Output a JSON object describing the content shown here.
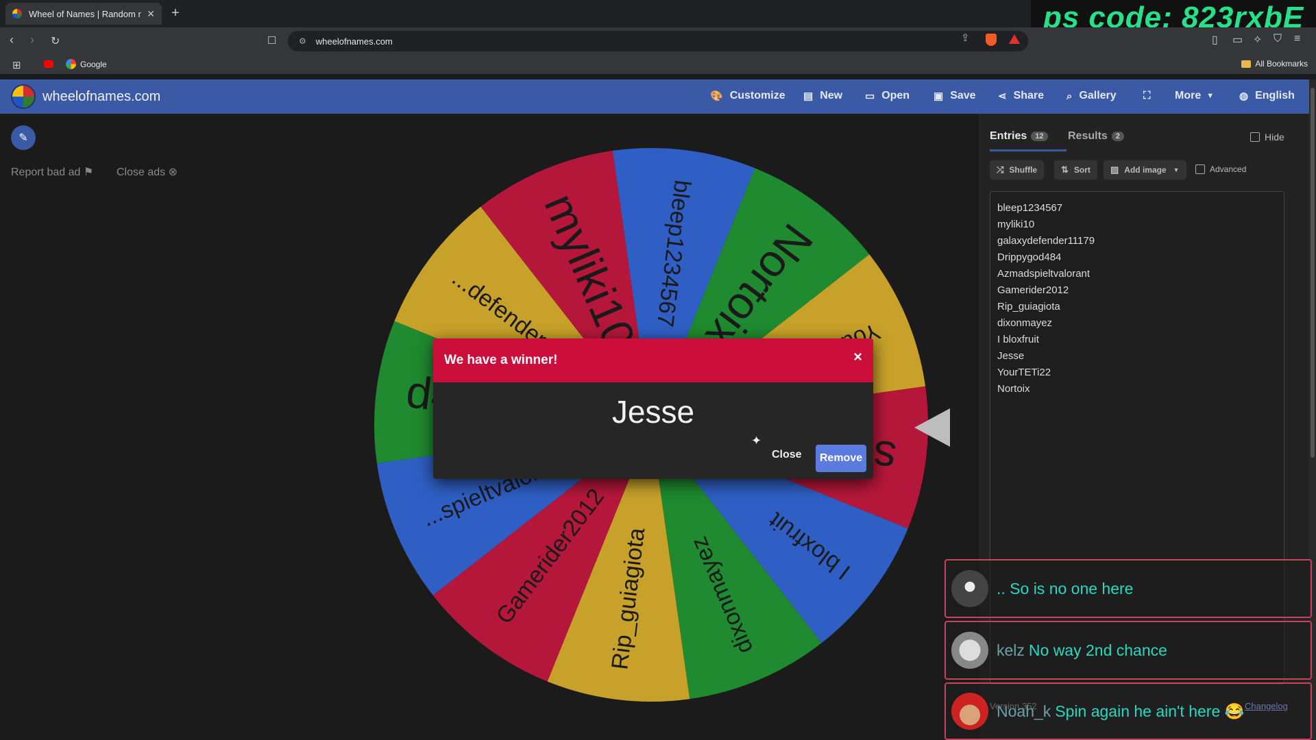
{
  "browser": {
    "tab_title": "Wheel of Names | Random nam",
    "new_tab_symbol": "+",
    "url": "wheelofnames.com",
    "bookmark_google": "Google",
    "all_bookmarks": "All Bookmarks"
  },
  "overlay": {
    "ps_code": "ps code: 823rxbE"
  },
  "header": {
    "site_name": "wheelofnames.com",
    "nav": {
      "customize": "Customize",
      "new": "New",
      "open": "Open",
      "save": "Save",
      "share": "Share",
      "gallery": "Gallery",
      "more": "More",
      "language": "English"
    }
  },
  "left": {
    "report_bad_ad": "Report bad ad",
    "close_ads": "Close ads"
  },
  "wheel": {
    "colors": {
      "red": "#b5173a",
      "yellow": "#c7a12a",
      "green": "#1f8a2f",
      "blue": "#2f5fc4"
    },
    "segment_labels": [
      "bleep1234567",
      "Nortoix",
      "YourTETi22",
      "se",
      "I bloxfruit",
      "dixonmayez",
      "Rip_guiagiota",
      "Gamerider2012",
      "...spieltvalora...",
      "d484",
      "...defender11...",
      "myliki10"
    ]
  },
  "panel": {
    "tab_entries": "Entries",
    "entries_count": "12",
    "tab_results": "Results",
    "results_count": "2",
    "hide_label": "Hide",
    "shuffle": "Shuffle",
    "sort": "Sort",
    "add_image": "Add image",
    "advanced": "Advanced",
    "entries": [
      "bleep1234567",
      "myliki10",
      "galaxydefender11179",
      "Drippygod484",
      "Azmadspieltvalorant",
      "Gamerider2012",
      "Rip_guiagiota",
      "dixonmayez",
      "I bloxfruit",
      "Jesse",
      "YourTETi22",
      "Nortoix"
    ]
  },
  "modal": {
    "title": "We have a winner!",
    "close_x": "×",
    "winner": "Jesse",
    "close_label": "Close",
    "remove_label": "Remove"
  },
  "chat": [
    {
      "user": "",
      "message": ".. So is no one here"
    },
    {
      "user": "kelz",
      "message": "No way 2nd chance"
    },
    {
      "user": "Noah_k",
      "message": "Spin again he ain't here 😂"
    }
  ],
  "footer": {
    "version": "Version 352",
    "changelog": "Changelog"
  }
}
